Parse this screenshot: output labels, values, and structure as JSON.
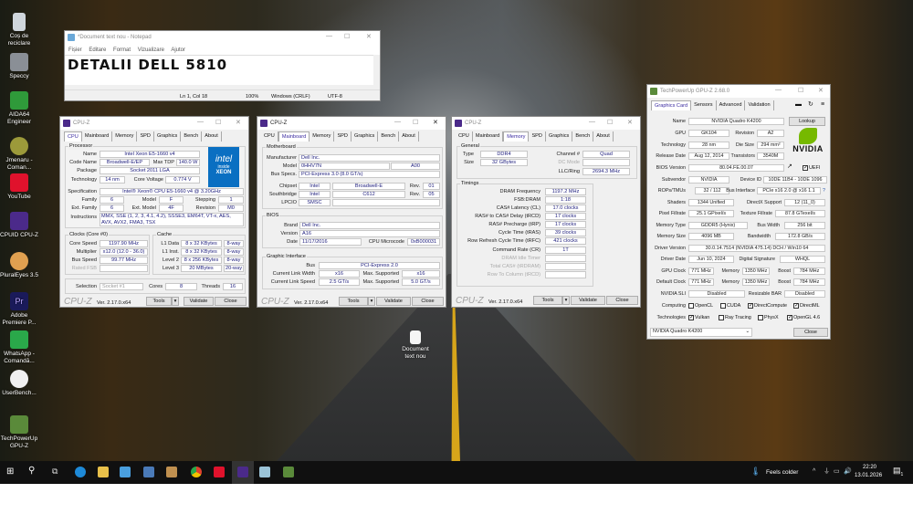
{
  "desktop": {
    "icons": [
      "Coș de reciclare",
      "Speccy",
      "AIDA64 Engineer",
      "Jmenaru - Coman...",
      "YouTube",
      "CPUID CPU-Z",
      "PluralEyes 3.5",
      "Adobe Premiere P...",
      "WhatsApp - Comandă...",
      "UserBench...",
      "TechPowerUp GPU-Z"
    ],
    "file": "Document text nou"
  },
  "notepad": {
    "title": "*Document text nou - Notepad",
    "menu": [
      "Fișier",
      "Editare",
      "Format",
      "Vizualizare",
      "Ajutor"
    ],
    "text": "DETALII DELL 5810",
    "status": {
      "pos": "Ln 1, Col 18",
      "zoom": "100%",
      "eol": "Windows (CRLF)",
      "enc": "UTF-8"
    }
  },
  "cpuz_common": {
    "title": "CPU-Z",
    "tabs": [
      "CPU",
      "Mainboard",
      "Memory",
      "SPD",
      "Graphics",
      "Bench",
      "About"
    ],
    "logo": "CPU-Z",
    "version": "Ver. 2.17.0.x64",
    "tools": "Tools",
    "validate": "Validate",
    "close": "Close"
  },
  "cpu": {
    "group": "Processor",
    "name_l": "Name",
    "name": "Intel Xeon E5-1660 v4",
    "code_l": "Code Name",
    "code": "Broadwell-E/EP",
    "tdp_l": "Max TDP",
    "tdp": "140.0 W",
    "pkg_l": "Package",
    "pkg": "Socket 2011 LGA",
    "tech_l": "Technology",
    "tech": "14 nm",
    "volt_l": "Core Voltage",
    "volt": "0.774 V",
    "spec_l": "Specification",
    "spec": "Intel® Xeon® CPU E5-1660 v4 @ 3.20GHz",
    "fam_l": "Family",
    "fam": "6",
    "model_l": "Model",
    "model": "F",
    "step_l": "Stepping",
    "step": "1",
    "efam_l": "Ext. Family",
    "efam": "6",
    "emodel_l": "Ext. Model",
    "emodel": "4F",
    "rev_l": "Revision",
    "rev": "M0",
    "instr_l": "Instructions",
    "instr": "MMX, SSE (1, 2, 3, 4.1, 4.2), SSSE3, EM64T, VT-x, AES, AVX, AVX2, FMA3, TSX",
    "clocks": "Clocks (Core #0)",
    "cs_l": "Core Speed",
    "cs": "1197.90 MHz",
    "mul_l": "Multiplier",
    "mul": "x12.0 (12.0 - 36.0)",
    "bus_l": "Bus Speed",
    "bus": "99.77 MHz",
    "fsb_l": "Rated FSB",
    "cache": "Cache",
    "l1d_l": "L1 Data",
    "l1d": "8 x 32 KBytes",
    "l1d_w": "8-way",
    "l1i_l": "L1 Inst.",
    "l1i": "8 x 32 KBytes",
    "l1i_w": "8-way",
    "l2_l": "Level 2",
    "l2": "8 x 256 KBytes",
    "l2_w": "8-way",
    "l3_l": "Level 3",
    "l3": "20 MBytes",
    "l3_w": "20-way",
    "sel_l": "Selection",
    "sel": "Socket #1",
    "cores_l": "Cores",
    "cores": "8",
    "thr_l": "Threads",
    "thr": "16",
    "intel": "intel",
    "inside": "inside",
    "xeon": "XEON"
  },
  "mb": {
    "group": "Motherboard",
    "man_l": "Manufacturer",
    "man": "Dell Inc.",
    "model_l": "Model",
    "model": "0HHV7N",
    "model_rev": "A00",
    "bus_l": "Bus Specs.",
    "bus": "PCI-Express 3.0 (8.0 GT/s)",
    "chip_l": "Chipset",
    "chip": "Intel",
    "chip_n": "Broadwell-E",
    "rev_l": "Rev.",
    "chip_r": "01",
    "sb_l": "Southbridge",
    "sb": "Intel",
    "sb_n": "C612",
    "sb_r": "05",
    "lpc_l": "LPCIO",
    "lpc": "SMSC",
    "bios": "BIOS",
    "brand_l": "Brand",
    "brand": "Dell Inc.",
    "ver_l": "Version",
    "ver": "A16",
    "date_l": "Date",
    "date": "11/17/2016",
    "mc_l": "CPU Microcode",
    "mc": "0xB000031",
    "gi": "Graphic Interface",
    "gbus_l": "Bus",
    "gbus": "PCI-Express 2.0",
    "clw_l": "Current Link Width",
    "clw": "x16",
    "max_l": "Max. Supported",
    "mlw": "x16",
    "cls_l": "Current Link Speed",
    "cls": "2.5 GT/s",
    "mls": "5.0 GT/s"
  },
  "mem": {
    "general": "General",
    "type_l": "Type",
    "type": "DDR4",
    "size_l": "Size",
    "size": "32 GBytes",
    "ch_l": "Channel #",
    "ch": "Quad",
    "dc_l": "DC Mode",
    "llc_l": "LLC/Ring",
    "llc": "2694.3 MHz",
    "timings": "Timings",
    "rows": [
      {
        "l": "DRAM Frequency",
        "v": "1197.2 MHz"
      },
      {
        "l": "FSB:DRAM",
        "v": "1:18"
      },
      {
        "l": "CAS# Latency (CL)",
        "v": "17.0 clocks"
      },
      {
        "l": "RAS# to CAS# Delay (tRCD)",
        "v": "17 clocks"
      },
      {
        "l": "RAS# Precharge (tRP)",
        "v": "17 clocks"
      },
      {
        "l": "Cycle Time (tRAS)",
        "v": "39 clocks"
      },
      {
        "l": "Row Refresh Cycle Time (tRFC)",
        "v": "421 clocks"
      },
      {
        "l": "Command Rate (CR)",
        "v": "1T"
      },
      {
        "l": "DRAM Idle Timer",
        "v": ""
      },
      {
        "l": "Total CAS# (tRDRAM)",
        "v": ""
      },
      {
        "l": "Row To Column (tRCD)",
        "v": ""
      }
    ]
  },
  "gpuz": {
    "title": "TechPowerUp GPU-Z 2.68.0",
    "tabs": [
      "Graphics Card",
      "Sensors",
      "Advanced",
      "Validation"
    ],
    "lookup": "Lookup",
    "brand": "NVIDIA",
    "uefi": "UEFI",
    "help": "?",
    "rows": {
      "name_l": "Name",
      "name": "NVIDIA Quadro K4200",
      "gpu_l": "GPU",
      "gpu": "GK104",
      "rev_l": "Revision",
      "rev": "A2",
      "tech_l": "Technology",
      "tech": "28 nm",
      "die_l": "Die Size",
      "die": "294 mm²",
      "rd_l": "Release Date",
      "rd": "Aug 12, 2014",
      "tr_l": "Transistors",
      "tr": "3540M",
      "bios_l": "BIOS Version",
      "bios": "80.04.FE.00.07",
      "sv_l": "Subvendor",
      "sv": "NVIDIA",
      "did_l": "Device ID",
      "did": "10DE 11B4 - 10DE 1096",
      "rop_l": "ROPs/TMUs",
      "rop": "32 / 112",
      "bi_l": "Bus Interface",
      "bi": "PCIe x16 2.0 @ x16 1.1",
      "sh_l": "Shaders",
      "sh": "1344 Unified",
      "dx_l": "DirectX Support",
      "dx": "12 (11_0)",
      "pf_l": "Pixel Fillrate",
      "pf": "25.1 GPixel/s",
      "tf_l": "Texture Fillrate",
      "tf": "87.8 GTexel/s",
      "mt_l": "Memory Type",
      "mt": "GDDR5 (Hynix)",
      "bw_l": "Bus Width",
      "bw": "256 bit",
      "ms_l": "Memory Size",
      "ms": "4096 MB",
      "band_l": "Bandwidth",
      "band": "172.8 GB/s",
      "dv_l": "Driver Version",
      "dv": "30.0.14.7514 (NVIDIA 475.14) DCH / Win10 64",
      "dd_l": "Driver Date",
      "dd": "Jun 10, 2024",
      "ds_l": "Digital Signature",
      "ds": "WHQL",
      "gc_l": "GPU Clock",
      "gc": "771 MHz",
      "mem_l": "Memory",
      "gm": "1350 MHz",
      "boost_l": "Boost",
      "gb": "784 MHz",
      "dc_l": "Default Clock",
      "dc": "771 MHz",
      "dm": "1350 MHz",
      "db": "784 MHz",
      "sli_l": "NVIDIA SLI",
      "sli": "Disabled",
      "rbar_l": "Resizable BAR",
      "rbar": "Disabled",
      "comp_l": "Computing",
      "techs_l": "Technologies"
    },
    "computing": [
      {
        "l": "OpenCL",
        "c": false
      },
      {
        "l": "CUDA",
        "c": false
      },
      {
        "l": "DirectCompute",
        "c": true
      },
      {
        "l": "DirectML",
        "c": true
      }
    ],
    "technologies": [
      {
        "l": "Vulkan",
        "c": true
      },
      {
        "l": "Ray Tracing",
        "c": false
      },
      {
        "l": "PhysX",
        "c": false
      },
      {
        "l": "OpenGL 4.6",
        "c": true
      }
    ],
    "select": "NVIDIA Quadro K4200",
    "close": "Close"
  },
  "taskbar": {
    "weather": "Feels colder",
    "time": "22:20",
    "date": "13.01.2026",
    "notif": "1"
  }
}
